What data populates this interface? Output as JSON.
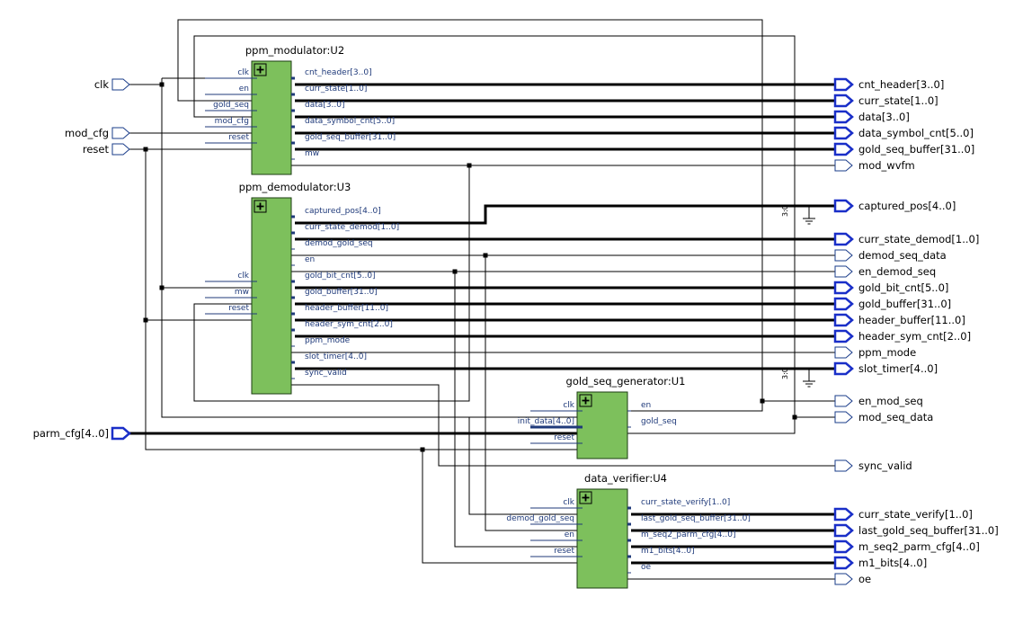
{
  "colors": {
    "block": "#7dc05c",
    "port": "#1a2fc8",
    "wire": "#000000",
    "pin": "#1f3a7a"
  },
  "modules": {
    "u2": {
      "title": "ppm_modulator:U2",
      "inputs": [
        "clk",
        "en",
        "gold_seq",
        "mod_cfg",
        "reset"
      ],
      "outputs": [
        "cnt_header[3..0]",
        "curr_state[1..0]",
        "data[3..0]",
        "data_symbol_cnt[5..0]",
        "gold_seq_buffer[31..0]",
        "mw"
      ]
    },
    "u3": {
      "title": "ppm_demodulator:U3",
      "inputs": [
        "clk",
        "mw",
        "reset"
      ],
      "outputs": [
        "captured_pos[4..0]",
        "curr_state_demod[1..0]",
        "demod_gold_seq",
        "en",
        "gold_bit_cnt[5..0]",
        "gold_buffer[31..0]",
        "header_buffer[11..0]",
        "header_sym_cnt[2..0]",
        "ppm_mode",
        "slot_timer[4..0]",
        "sync_valid"
      ]
    },
    "u1": {
      "title": "gold_seq_generator:U1",
      "inputs": [
        "clk",
        "init_data[4..0]",
        "reset"
      ],
      "outputs": [
        "en",
        "gold_seq"
      ]
    },
    "u4": {
      "title": "data_verifier:U4",
      "inputs": [
        "clk",
        "demod_gold_seq",
        "en",
        "reset"
      ],
      "outputs": [
        "curr_state_verify[1..0]",
        "last_gold_seq_buffer[31..0]",
        "m_seq2_parm_cfg[4..0]",
        "m1_bits[4..0]",
        "oe"
      ]
    }
  },
  "top_inputs": [
    "clk",
    "mod_cfg",
    "reset",
    "parm_cfg[4..0]"
  ],
  "top_outputs": [
    "cnt_header[3..0]",
    "curr_state[1..0]",
    "data[3..0]",
    "data_symbol_cnt[5..0]",
    "gold_seq_buffer[31..0]",
    "mod_wvfm",
    "captured_pos[4..0]",
    "curr_state_demod[1..0]",
    "demod_seq_data",
    "en_demod_seq",
    "gold_bit_cnt[5..0]",
    "gold_buffer[31..0]",
    "header_buffer[11..0]",
    "header_sym_cnt[2..0]",
    "ppm_mode",
    "slot_timer[4..0]",
    "en_mod_seq",
    "mod_seq_data",
    "sync_valid",
    "curr_state_verify[1..0]",
    "last_gold_seq_buffer[31..0]",
    "m_seq2_parm_cfg[4..0]",
    "m1_bits[4..0]",
    "oe"
  ],
  "constants": [
    "3:0",
    "3:0"
  ]
}
